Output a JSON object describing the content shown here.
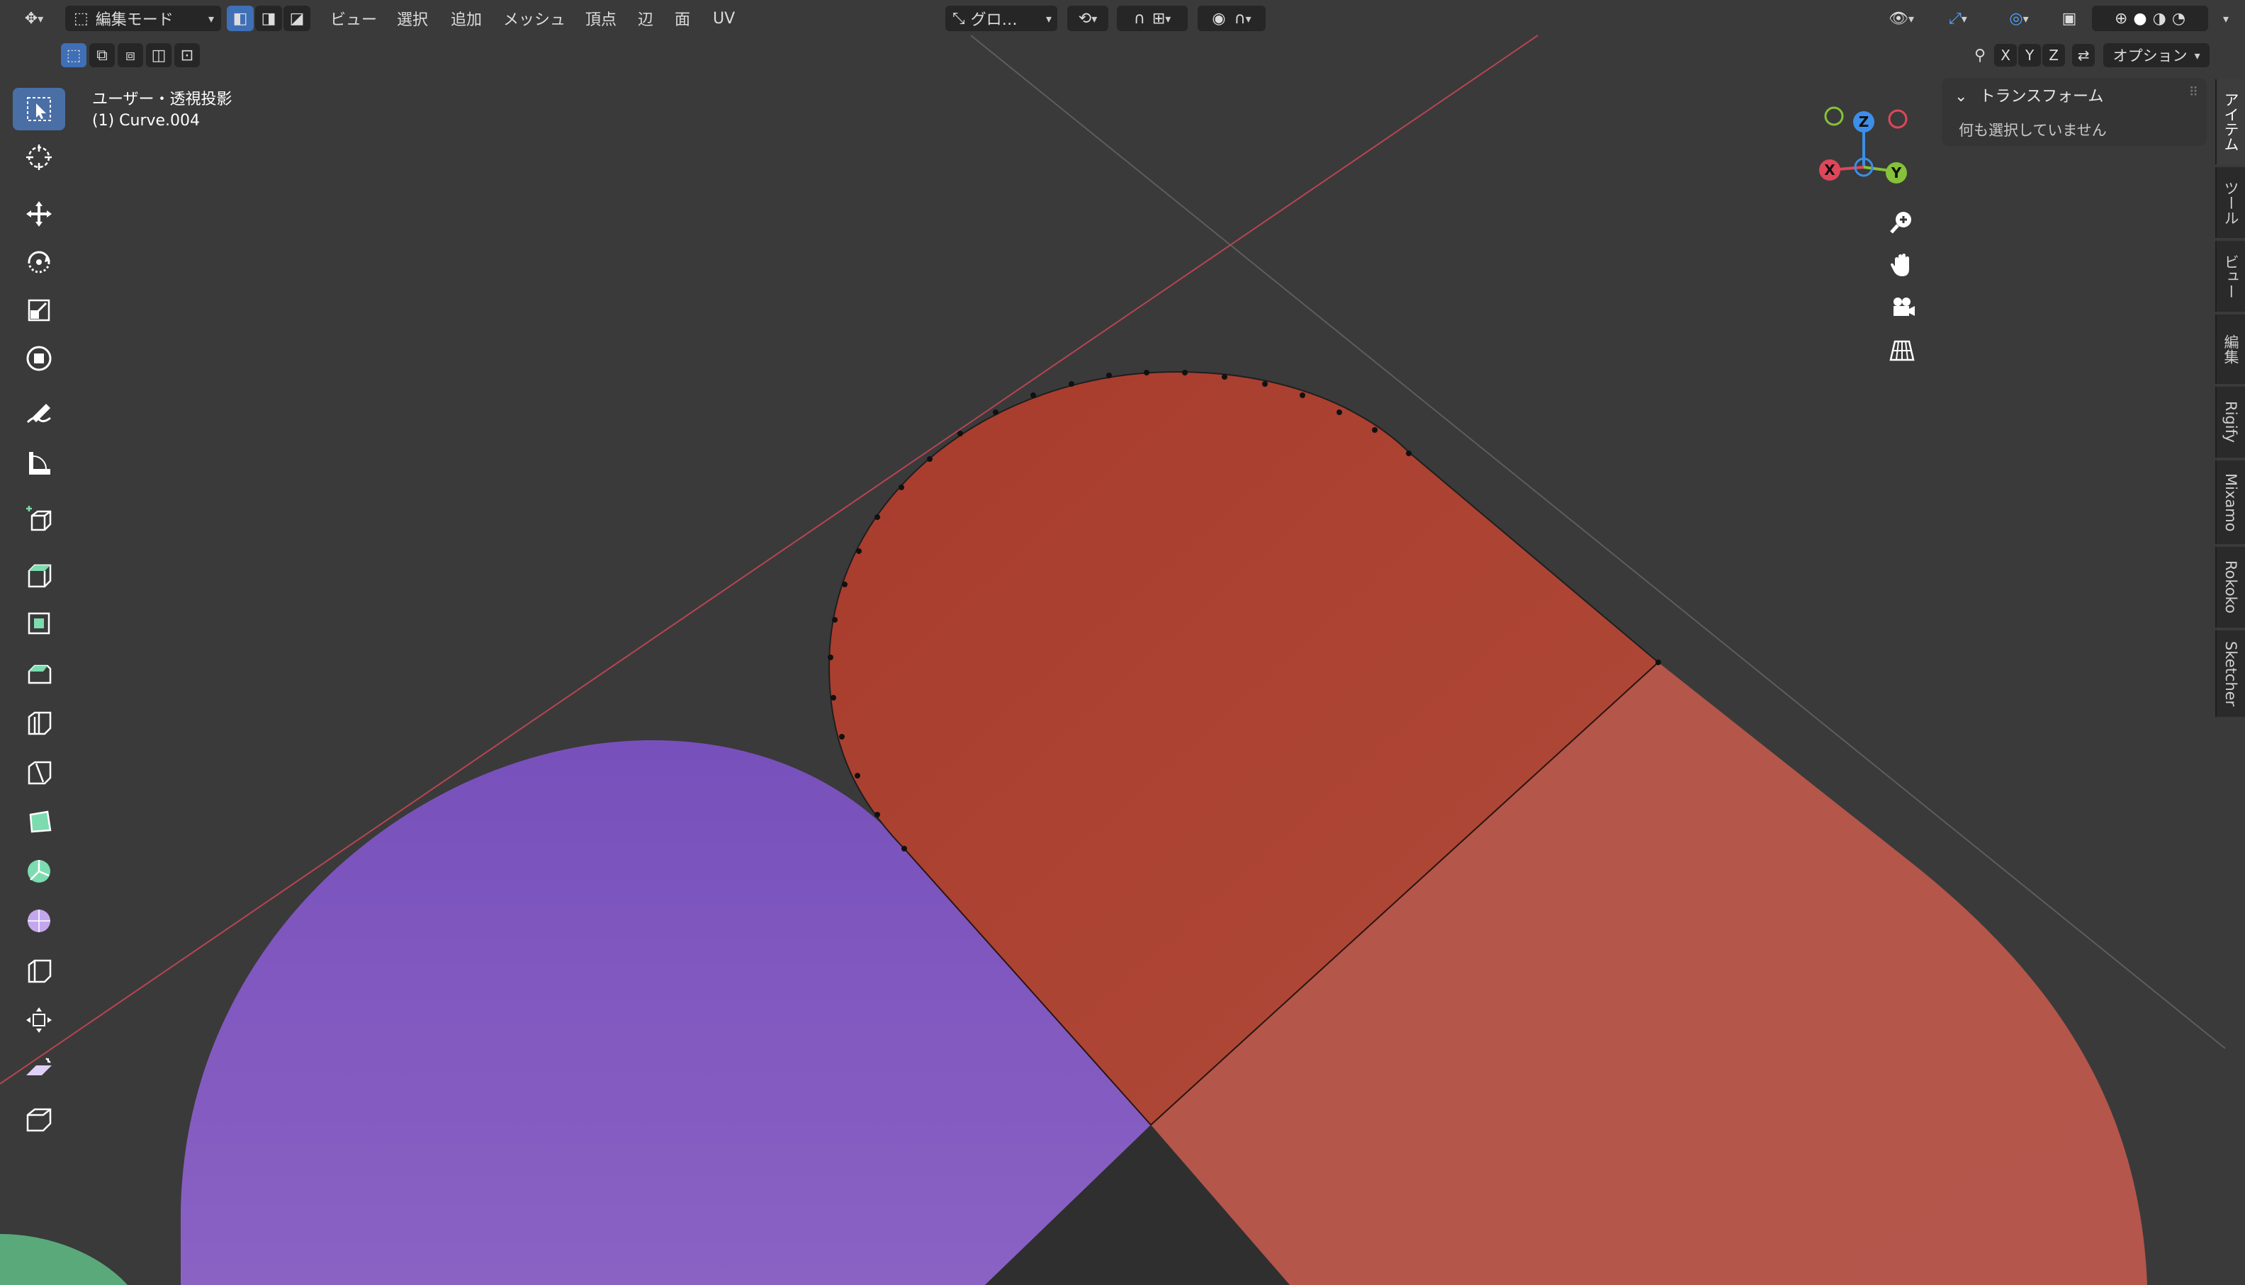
{
  "header": {
    "mode_label": "編集モード",
    "menus": [
      "ビュー",
      "選択",
      "追加",
      "メッシュ",
      "頂点",
      "辺",
      "面",
      "UV"
    ],
    "transform_orientation": "グロ…",
    "options_label": "オプション",
    "axis_x": "X",
    "axis_y": "Y",
    "axis_z": "Z"
  },
  "viewport": {
    "view_label": "ユーザー・透視投影",
    "object_label": "(1) Curve.004"
  },
  "gizmo": {
    "x": "X",
    "y": "Y",
    "z": "Z"
  },
  "npanel": {
    "title": "トランスフォーム",
    "empty_message": "何も選択していません"
  },
  "tabs": [
    "アイテム",
    "ツール",
    "ビュー",
    "編集",
    "Rigify",
    "Mixamo",
    "Rokoko",
    "Sketcher"
  ],
  "colors": {
    "viewport_bg": "#3a3a3a",
    "red_shape": "#a9402e",
    "red_shape_light": "#b45548",
    "purple_shape": "#7c54bd",
    "green_shape": "#5aa97a",
    "active_tool": "#4a6fa6",
    "x_axis": "#e0465a",
    "y_axis": "#86c13a",
    "z_axis": "#3d8ee8"
  },
  "tools": [
    {
      "icon": "select-box-icon"
    },
    {
      "icon": "cursor-icon"
    },
    {
      "icon": "move-icon"
    },
    {
      "icon": "rotate-icon"
    },
    {
      "icon": "scale-icon"
    },
    {
      "icon": "transform-icon"
    },
    {
      "icon": "annotate-icon"
    },
    {
      "icon": "measure-icon"
    },
    {
      "icon": "add-cube-icon"
    },
    {
      "icon": "extrude-icon"
    },
    {
      "icon": "inset-icon"
    },
    {
      "icon": "bevel-icon"
    },
    {
      "icon": "loop-cut-icon"
    },
    {
      "icon": "knife-icon"
    },
    {
      "icon": "poly-build-icon"
    },
    {
      "icon": "spin-icon"
    },
    {
      "icon": "smooth-icon"
    },
    {
      "icon": "edge-slide-icon"
    },
    {
      "icon": "shrink-fatten-icon"
    },
    {
      "icon": "shear-icon"
    },
    {
      "icon": "rip-region-icon"
    }
  ]
}
